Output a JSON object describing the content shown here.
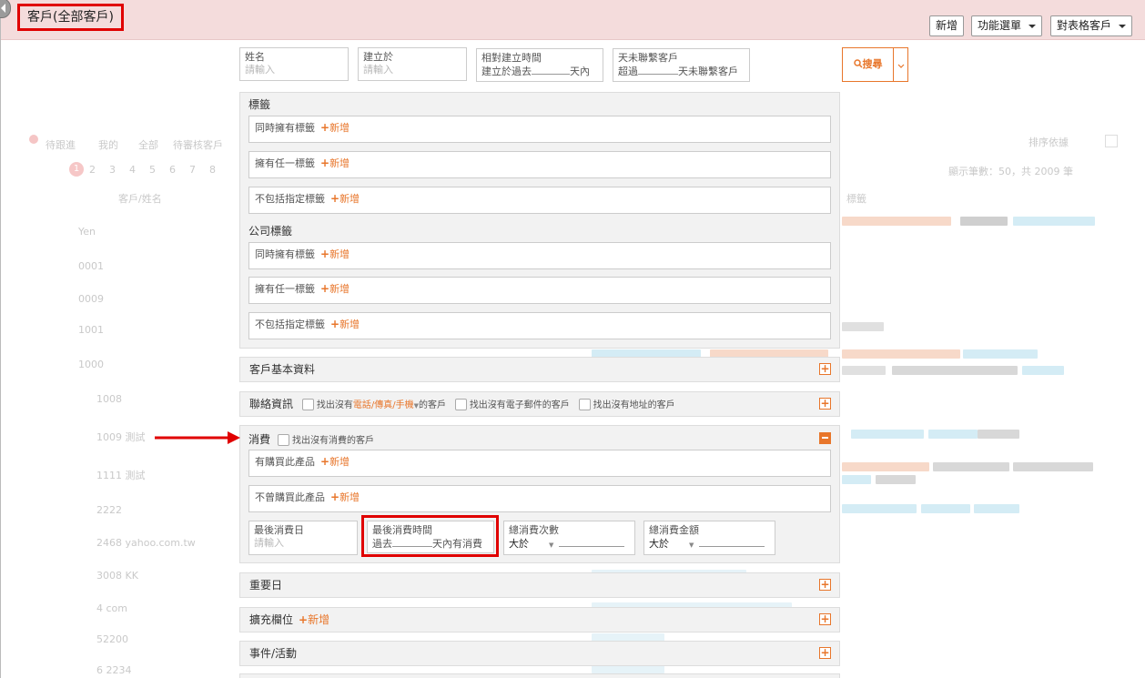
{
  "header": {
    "title": "客戶(全部客戶)",
    "buttons": {
      "add": "新增",
      "menu": "功能選單",
      "table_customers": "對表格客戶"
    }
  },
  "background": {
    "tabs": [
      "待跟進",
      "我的",
      "全部",
      "待審核客戶"
    ],
    "right_select": "排序依據",
    "pager": [
      "1",
      "2",
      "3",
      "4",
      "5",
      "6",
      "7",
      "8"
    ],
    "page_info": "顯示筆數：50，共 2009 筆",
    "col_name": "客戶/姓名",
    "col_tags": "標籤",
    "rows": [
      "Yen",
      "0001",
      "0009",
      "1001",
      "1000",
      "1008",
      "1009 測試",
      "1111 測試",
      "2222",
      "2468 yahoo.com.tw",
      "3008 KK",
      "4 com",
      "52200",
      "6 2234"
    ]
  },
  "filters": {
    "name": {
      "label": "姓名",
      "placeholder": "請輸入"
    },
    "created_at": {
      "label": "建立於",
      "placeholder": "請輸入"
    },
    "relative_created": {
      "label": "相對建立時間",
      "prefix": "建立於過去",
      "suffix": "天內"
    },
    "no_contact": {
      "label": "天未聯繫客戶",
      "prefix": "超過",
      "suffix": "天未聯繫客戶"
    }
  },
  "search": {
    "label": "搜尋"
  },
  "tags": {
    "title": "標籤",
    "items": [
      "同時擁有標籤",
      "擁有任一標籤",
      "不包括指定標籤"
    ],
    "add": "新增"
  },
  "company_tags": {
    "title": "公司標籤",
    "items": [
      "同時擁有標籤",
      "擁有任一標籤",
      "不包括指定標籤"
    ]
  },
  "sections": {
    "basic": "客戶基本資料",
    "contact": {
      "title": "聯絡資訊",
      "opt1_a": "找出沒有",
      "opt1_link": "電話/傳真/手機",
      "opt1_b": "的客戶",
      "opt2": "找出沒有電子郵件的客戶",
      "opt3": "找出沒有地址的客戶"
    },
    "consume": {
      "title": "消費",
      "opt": "找出沒有消費的客戶",
      "bought": "有購買此產品",
      "not_bought": "不曾購買此產品",
      "last_date": {
        "label": "最後消費日",
        "placeholder": "請輸入"
      },
      "last_time": {
        "label": "最後消費時間",
        "prefix": "過去",
        "suffix": "天內有消費"
      },
      "count": {
        "label": "總消費次數",
        "op": "大於"
      },
      "amount": {
        "label": "總消費金額",
        "op": "大於"
      }
    },
    "important": "重要日",
    "extended": "擴充欄位",
    "events": "事件/活動"
  },
  "colors": {
    "accent": "#e8762b",
    "highlight": "#e00000",
    "topbar": "#f4dcdc"
  }
}
